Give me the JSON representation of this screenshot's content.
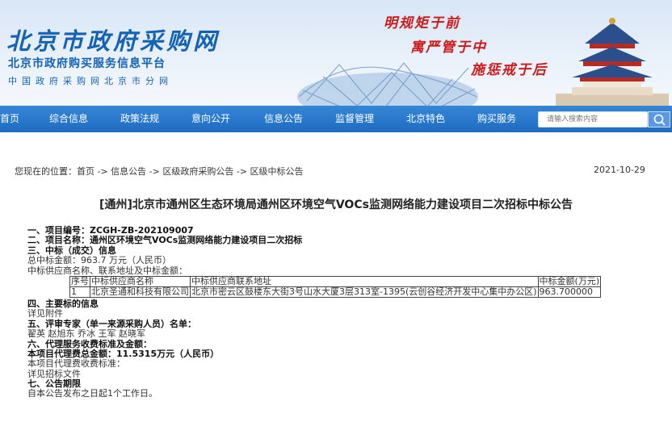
{
  "header": {
    "site_title": "北京市政府采购网",
    "site_subtitle": "北京市政府购买服务信息平台",
    "site_subtitle2": "中国政府采购网北京市分网",
    "slogans": [
      "明规矩于前",
      "寓严管于中",
      "施惩戒于后"
    ]
  },
  "nav": {
    "items": [
      "首页",
      "综合信息",
      "政策法规",
      "意向公开",
      "信息公告",
      "监督管理",
      "北京特色",
      "购买服务"
    ],
    "search_placeholder": "请输入搜索内容"
  },
  "breadcrumb": {
    "text": "您现在的位置：首页 -> 信息公告 -> 区级政府采购公告 -> 区级中标公告",
    "date": "2021-10-29"
  },
  "article": {
    "title": "[通州]北京市通州区生态环境局通州区环境空气VOCs监测网络能力建设项目二次招标中标公告",
    "project_no": "一、项目编号：ZCGH-ZB-202109007",
    "project_name": "二、项目名称：通州区环境空气VOCs监测网络能力建设项目二次招标",
    "sec3_heading": "三、中标（成交）信息",
    "total_amount": "总中标金额：963.7 万元（人民币）",
    "supplier_intro": "中标供应商名称、联系地址及中标金额：",
    "table": {
      "headers": [
        "序号",
        "中标供应商名称",
        "中标供应商联系地址",
        "中标金额(万元)"
      ],
      "rows": [
        [
          "1",
          "北京圣通和科技有限公司",
          "北京市密云区鼓楼东大街3号山水大厦3层313室-1395(云创谷经济开发中心集中办公区)",
          "963.700000"
        ]
      ]
    },
    "sec4_heading": "四、主要标的信息",
    "sec4_text": "详见附件",
    "sec5_heading": "五、评审专家（单一来源采购人员）名单：",
    "sec5_text": "翟英 赵旭东 乔冰 王军 赵晓军",
    "sec6_heading": "六、代理服务收费标准及金额：",
    "sec6_total": "本项目代理费总金额：11.5315万元（人民币）",
    "sec6_std": "本项目代理费收费标准：",
    "sec6_detail": "详见招标文件",
    "sec7_heading": "七、公告期限",
    "sec7_text": "自本公告发布之日起1个工作日。"
  },
  "colors": {
    "nav_blue": "#1e6cc0",
    "title_blue": "#1462b4",
    "slogan_red": "#cc1a1a"
  },
  "icons": [
    "search-icon"
  ]
}
